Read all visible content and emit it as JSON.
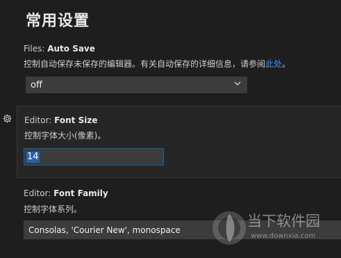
{
  "page": {
    "title": "常用设置"
  },
  "settings": [
    {
      "category": "Files: ",
      "name": "Auto Save",
      "description_before": "控制自动保存未保存的编辑器。有关自动保存的详细信息，请参阅",
      "link_text": "此处",
      "description_after": "。",
      "control": "select",
      "value": "off"
    },
    {
      "category": "Editor: ",
      "name": "Font Size",
      "description": "控制字体大小(像素)。",
      "control": "number",
      "value": "14"
    },
    {
      "category": "Editor: ",
      "name": "Font Family",
      "description": "控制字体系列。",
      "control": "text",
      "value": "Consolas, 'Courier New', monospace"
    }
  ],
  "watermark": {
    "name": "当下软件园",
    "url": "www.downxia.com"
  },
  "colors": {
    "background": "#1e1e1e",
    "link": "#3794ff",
    "focus_border": "#0e639c",
    "input_bg": "#3c3c3c"
  },
  "icons": {
    "settings_gear": "gear-icon",
    "dropdown": "chevron-down-icon"
  }
}
